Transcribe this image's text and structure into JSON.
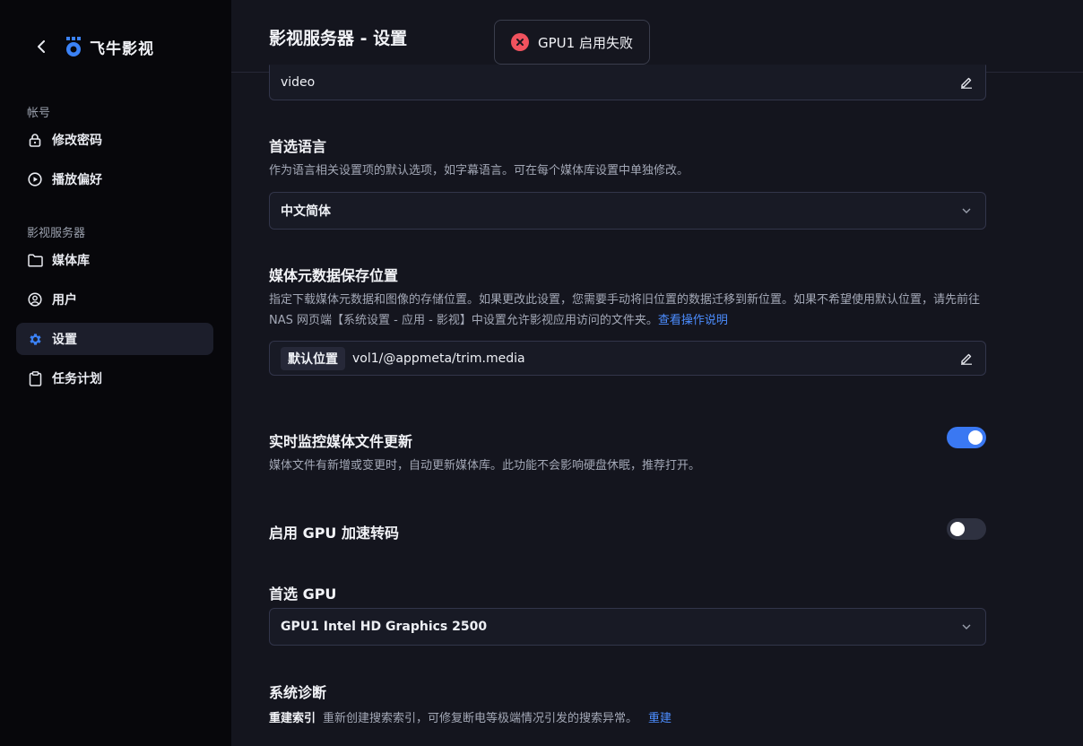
{
  "app": {
    "name": "飞牛影视"
  },
  "sidebar": {
    "section_account": "帐号",
    "section_server": "影视服务器",
    "items": [
      {
        "label": "修改密码",
        "icon": "lock-icon"
      },
      {
        "label": "播放偏好",
        "icon": "play-circle-icon"
      },
      {
        "label": "媒体库",
        "icon": "folder-icon"
      },
      {
        "label": "用户",
        "icon": "user-icon"
      },
      {
        "label": "设置",
        "icon": "gear-icon",
        "active": true
      },
      {
        "label": "任务计划",
        "icon": "clipboard-icon"
      }
    ]
  },
  "header": {
    "title": "影视服务器 - 设置"
  },
  "toast": {
    "message": "GPU1 启用失败",
    "icon": "error-icon"
  },
  "settings": {
    "name_field": {
      "value": "video"
    },
    "language": {
      "title": "首选语言",
      "description": "作为语言相关设置项的默认选项，如字幕语言。可在每个媒体库设置中单独修改。",
      "selected": "中文简体"
    },
    "metadata": {
      "title": "媒体元数据保存位置",
      "description_line1": "指定下载媒体元数据和图像的存储位置。如果更改此设置，您需要手动将旧位置的数据迁移到新位置。如果不希望使用默认位置，请先前往",
      "description_line2": "NAS 网页端【系统设置 - 应用 - 影视】中设置允许影视应用访问的文件夹。",
      "link": "查看操作说明",
      "tag": "默认位置",
      "path": "vol1/@appmeta/trim.media"
    },
    "realtime_monitor": {
      "title": "实时监控媒体文件更新",
      "description": "媒体文件有新增或变更时，自动更新媒体库。此功能不会影响硬盘休眠，推荐打开。",
      "enabled": true
    },
    "gpu_transcode": {
      "title": "启用 GPU 加速转码",
      "enabled": false
    },
    "preferred_gpu": {
      "title": "首选 GPU",
      "selected": "GPU1 Intel HD Graphics 2500"
    },
    "diagnostics": {
      "title": "系统诊断",
      "rebuild_label": "重建索引",
      "rebuild_desc": "重新创建搜索索引，可修复断电等极端情况引发的搜索异常。",
      "rebuild_action": "重建"
    }
  },
  "colors": {
    "accent": "#3a78f2",
    "link": "#4c8dff",
    "error": "#f0525e",
    "sidebar_bg": "#07070b",
    "main_bg": "#14151e"
  }
}
